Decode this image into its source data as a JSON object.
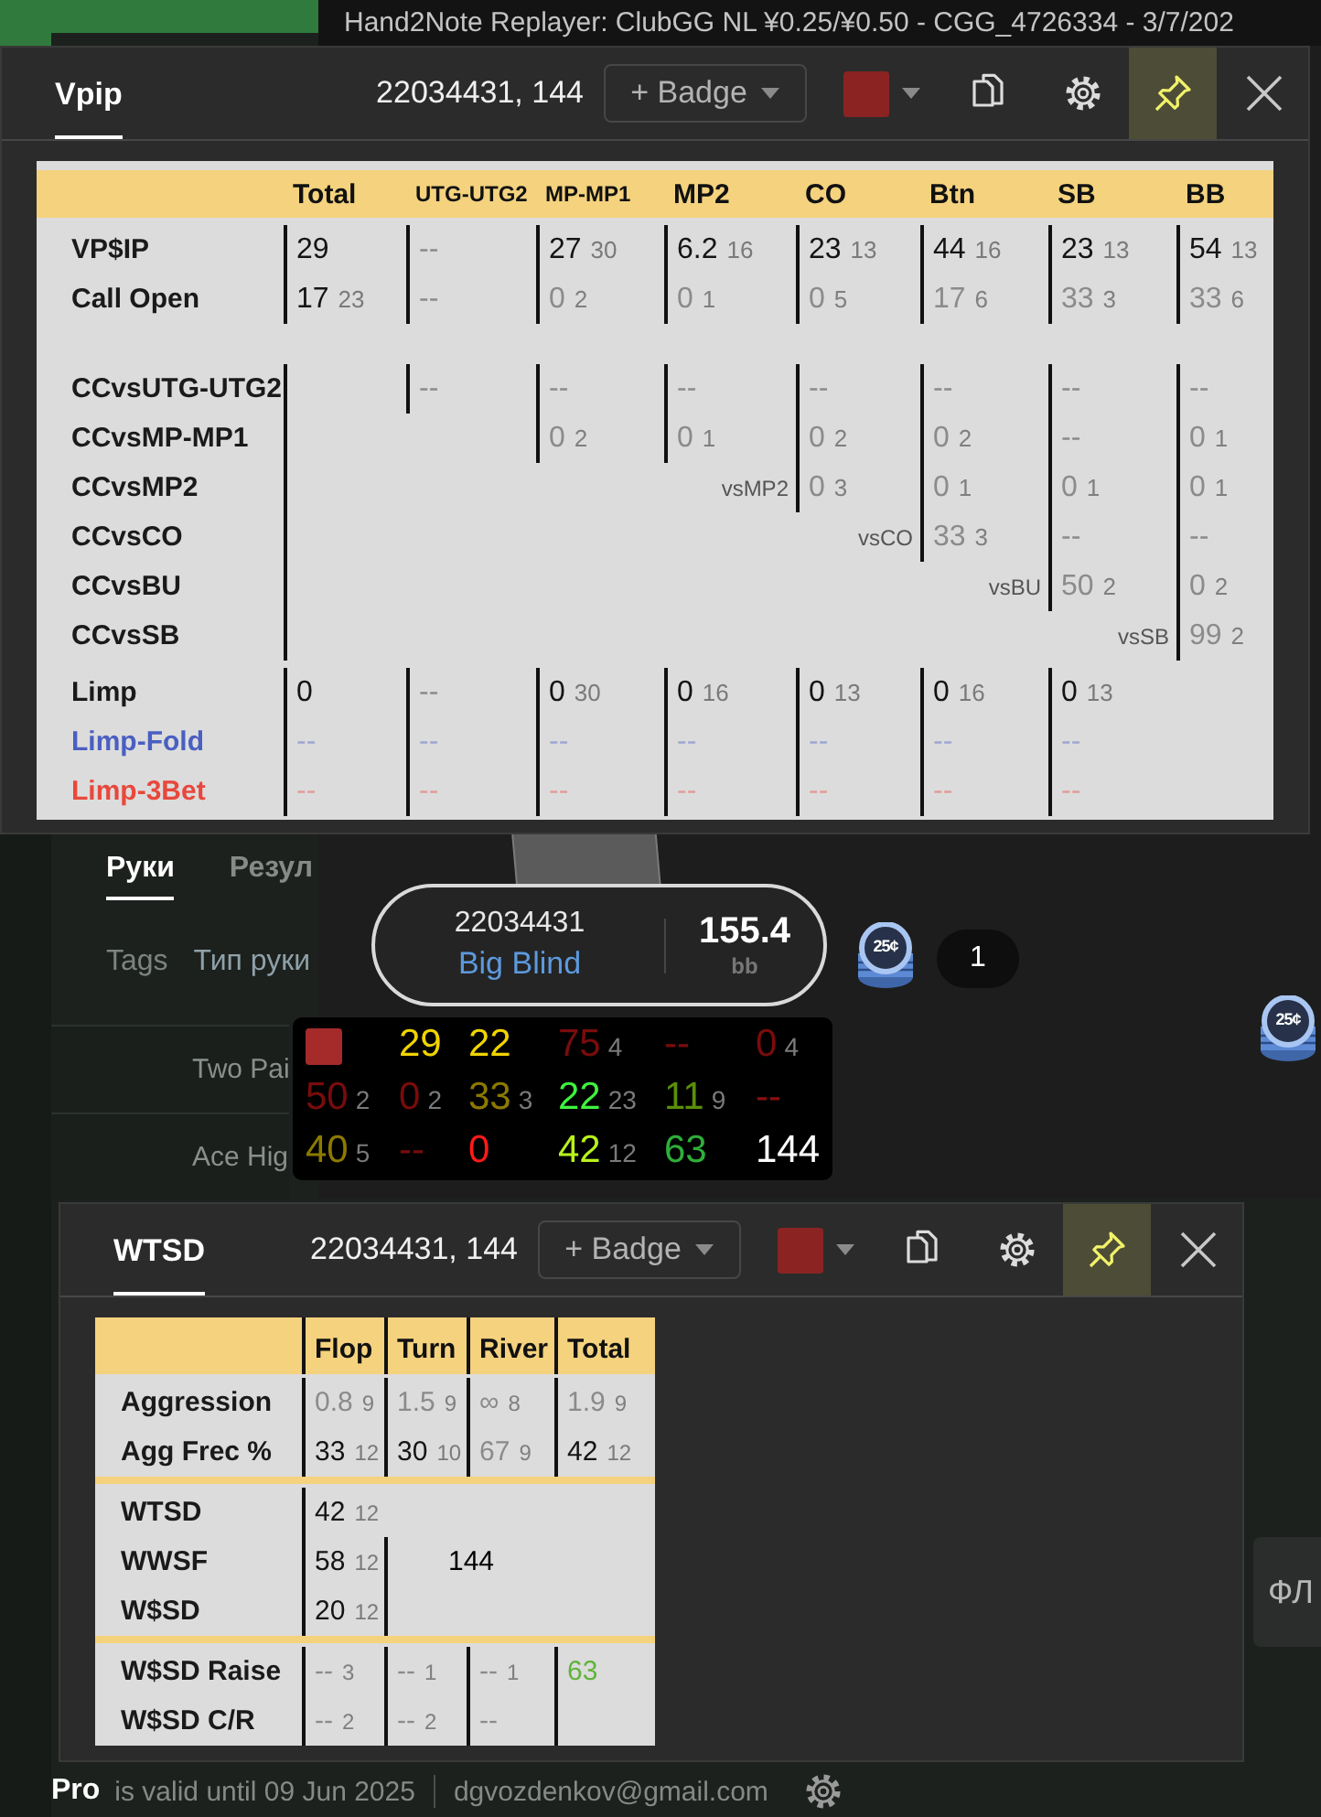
{
  "replayer": {
    "title": "Hand2Note Replayer: ClubGG NL ¥0.25/¥0.50 - CGG_4726334 - 3/7/202",
    "player": {
      "id": "22034431",
      "position": "Big Blind",
      "stack": "155.4",
      "unit": "bb"
    },
    "chips": [
      "25¢",
      "25¢"
    ],
    "bet": "1",
    "hud": {
      "rows": [
        [
          {
            "kind": "swatch",
            "color": "#a52a2a"
          },
          {
            "kind": "stat",
            "value": "29",
            "color": "#f0d400"
          },
          {
            "kind": "stat",
            "value": "22",
            "color": "#f0d400"
          },
          {
            "kind": "stat",
            "value": "75",
            "count": "4",
            "color": "#7a0c0c"
          },
          {
            "kind": "stat",
            "value": "--",
            "color": "#7a0c0c"
          },
          {
            "kind": "stat",
            "value": "0",
            "count": "4",
            "color": "#7a0c0c"
          }
        ],
        [
          {
            "kind": "stat",
            "value": "50",
            "count": "2",
            "color": "#7a0c0c"
          },
          {
            "kind": "stat",
            "value": "0",
            "count": "2",
            "color": "#7a0c0c"
          },
          {
            "kind": "stat",
            "value": "33",
            "count": "3",
            "color": "#8c7a00"
          },
          {
            "kind": "stat",
            "value": "22",
            "count": "23",
            "color": "#3ef23e"
          },
          {
            "kind": "stat",
            "value": "11",
            "count": "9",
            "color": "#5a8f0a"
          },
          {
            "kind": "stat",
            "value": "--",
            "color": "#8a1010"
          }
        ],
        [
          {
            "kind": "stat",
            "value": "40",
            "count": "5",
            "color": "#8c7a00"
          },
          {
            "kind": "stat",
            "value": "--",
            "color": "#7a0c0c"
          },
          {
            "kind": "stat",
            "value": "0",
            "color": "#ff1a1a"
          },
          {
            "kind": "stat",
            "value": "42",
            "count": "12",
            "color": "#b8f21c"
          },
          {
            "kind": "stat",
            "value": "63",
            "color": "#2fae3a"
          },
          {
            "kind": "stat",
            "value": "144",
            "color": "#ffffff"
          }
        ]
      ]
    }
  },
  "app": {
    "tabs": [
      {
        "label": "Руки",
        "selected": true
      },
      {
        "label": "Резул",
        "selected": false
      }
    ],
    "filters": [
      "Tags",
      "Тип руки"
    ],
    "hands": [
      "Two Pai",
      "Ace Hig"
    ],
    "side_button": "ФЛ",
    "footer": {
      "plan": "Pro",
      "validity": "is valid until 09 Jun 2025",
      "email": "dgvozdenkov@gmail.com"
    }
  },
  "popups": [
    {
      "tab": {
        "label": "Vpip",
        "selected": true
      },
      "players": "22034431, 144",
      "badge_button": "+ Badge",
      "color": "#8b2323",
      "pinned": true,
      "table": {
        "divider_lines": false,
        "header_rules": false,
        "columns": [
          "Total",
          "UTG-UTG2",
          "MP-MP1",
          "MP2",
          "CO",
          "Btn",
          "SB",
          "BB"
        ],
        "sections": [
          [
            {
              "label": "VP$IP",
              "color": "#1a1a1a",
              "cells": [
                {
                  "kind": "stat",
                  "value": "29",
                  "faded": false
                },
                {
                  "kind": "stat",
                  "value": "--",
                  "faded": true
                },
                {
                  "kind": "stat",
                  "value": "27",
                  "count": "30",
                  "faded": false
                },
                {
                  "kind": "stat",
                  "value": "6.2",
                  "count": "16",
                  "faded": false
                },
                {
                  "kind": "stat",
                  "value": "23",
                  "count": "13",
                  "faded": false
                },
                {
                  "kind": "stat",
                  "value": "44",
                  "count": "16",
                  "faded": false
                },
                {
                  "kind": "stat",
                  "value": "23",
                  "count": "13",
                  "faded": false
                },
                {
                  "kind": "stat",
                  "value": "54",
                  "count": "13",
                  "faded": false
                }
              ]
            },
            {
              "label": "Call Open",
              "color": "#1a1a1a",
              "cells": [
                {
                  "kind": "stat",
                  "value": "17",
                  "count": "23",
                  "faded": false
                },
                {
                  "kind": "stat",
                  "value": "--",
                  "faded": true
                },
                {
                  "kind": "stat",
                  "value": "0",
                  "count": "2",
                  "faded": true
                },
                {
                  "kind": "stat",
                  "value": "0",
                  "count": "1",
                  "faded": true
                },
                {
                  "kind": "stat",
                  "value": "0",
                  "count": "5",
                  "faded": true
                },
                {
                  "kind": "stat",
                  "value": "17",
                  "count": "6",
                  "faded": true
                },
                {
                  "kind": "stat",
                  "value": "33",
                  "count": "3",
                  "faded": true
                },
                {
                  "kind": "stat",
                  "value": "33",
                  "count": "6",
                  "faded": true
                }
              ]
            }
          ],
          [
            {
              "label": "CCvsUTG-UTG2",
              "color": "#1a1a1a",
              "cells": [
                {
                  "kind": "bar"
                },
                {
                  "kind": "stat",
                  "value": "--",
                  "faded": true
                },
                {
                  "kind": "stat",
                  "value": "--",
                  "faded": true
                },
                {
                  "kind": "stat",
                  "value": "--",
                  "faded": true
                },
                {
                  "kind": "stat",
                  "value": "--",
                  "faded": true
                },
                {
                  "kind": "stat",
                  "value": "--",
                  "faded": true
                },
                {
                  "kind": "stat",
                  "value": "--",
                  "faded": true
                },
                {
                  "kind": "stat",
                  "value": "--",
                  "faded": true
                }
              ]
            },
            {
              "label": "CCvsMP-MP1",
              "color": "#1a1a1a",
              "cells": [
                {
                  "kind": "bar"
                },
                {
                  "kind": "blank"
                },
                {
                  "kind": "stat",
                  "value": "0",
                  "count": "2",
                  "faded": true
                },
                {
                  "kind": "stat",
                  "value": "0",
                  "count": "1",
                  "faded": true
                },
                {
                  "kind": "stat",
                  "value": "0",
                  "count": "2",
                  "faded": true
                },
                {
                  "kind": "stat",
                  "value": "0",
                  "count": "2",
                  "faded": true
                },
                {
                  "kind": "stat",
                  "value": "--",
                  "faded": true
                },
                {
                  "kind": "stat",
                  "value": "0",
                  "count": "1",
                  "faded": true
                }
              ]
            },
            {
              "label": "CCvsMP2",
              "color": "#1a1a1a",
              "cells": [
                {
                  "kind": "bar"
                },
                {
                  "kind": "blank"
                },
                {
                  "kind": "blank"
                },
                {
                  "kind": "label",
                  "text": "vsMP2"
                },
                {
                  "kind": "stat",
                  "value": "0",
                  "count": "3",
                  "faded": true
                },
                {
                  "kind": "stat",
                  "value": "0",
                  "count": "1",
                  "faded": true
                },
                {
                  "kind": "stat",
                  "value": "0",
                  "count": "1",
                  "faded": true
                },
                {
                  "kind": "stat",
                  "value": "0",
                  "count": "1",
                  "faded": true
                }
              ]
            },
            {
              "label": "CCvsCO",
              "color": "#1a1a1a",
              "cells": [
                {
                  "kind": "bar"
                },
                {
                  "kind": "blank"
                },
                {
                  "kind": "blank"
                },
                {
                  "kind": "blank"
                },
                {
                  "kind": "label",
                  "text": "vsCO"
                },
                {
                  "kind": "stat",
                  "value": "33",
                  "count": "3",
                  "faded": true
                },
                {
                  "kind": "stat",
                  "value": "--",
                  "faded": true
                },
                {
                  "kind": "stat",
                  "value": "--",
                  "faded": true
                }
              ]
            },
            {
              "label": "CCvsBU",
              "color": "#1a1a1a",
              "cells": [
                {
                  "kind": "bar"
                },
                {
                  "kind": "blank"
                },
                {
                  "kind": "blank"
                },
                {
                  "kind": "blank"
                },
                {
                  "kind": "blank"
                },
                {
                  "kind": "label",
                  "text": "vsBU"
                },
                {
                  "kind": "stat",
                  "value": "50",
                  "count": "2",
                  "faded": true
                },
                {
                  "kind": "stat",
                  "value": "0",
                  "count": "2",
                  "faded": true
                }
              ]
            },
            {
              "label": "CCvsSB",
              "color": "#1a1a1a",
              "cells": [
                {
                  "kind": "bar"
                },
                {
                  "kind": "blank"
                },
                {
                  "kind": "blank"
                },
                {
                  "kind": "blank"
                },
                {
                  "kind": "blank"
                },
                {
                  "kind": "blank"
                },
                {
                  "kind": "label",
                  "text": "vsSB"
                },
                {
                  "kind": "stat",
                  "value": "99",
                  "count": "2",
                  "faded": true
                }
              ]
            }
          ],
          [
            {
              "label": "Limp",
              "color": "#1a1a1a",
              "cells": [
                {
                  "kind": "stat",
                  "value": "0",
                  "faded": false
                },
                {
                  "kind": "stat",
                  "value": "--",
                  "faded": true
                },
                {
                  "kind": "stat",
                  "value": "0",
                  "count": "30",
                  "faded": false
                },
                {
                  "kind": "stat",
                  "value": "0",
                  "count": "16",
                  "faded": false
                },
                {
                  "kind": "stat",
                  "value": "0",
                  "count": "13",
                  "faded": false
                },
                {
                  "kind": "stat",
                  "value": "0",
                  "count": "16",
                  "faded": false
                },
                {
                  "kind": "stat",
                  "value": "0",
                  "count": "13",
                  "faded": false
                },
                {
                  "kind": "blank"
                }
              ]
            },
            {
              "label": "Limp-Fold",
              "color": "#4a5fc1",
              "cells": [
                {
                  "kind": "stat",
                  "value": "--",
                  "faded": true
                },
                {
                  "kind": "stat",
                  "value": "--",
                  "faded": true
                },
                {
                  "kind": "stat",
                  "value": "--",
                  "faded": true
                },
                {
                  "kind": "stat",
                  "value": "--",
                  "faded": true
                },
                {
                  "kind": "stat",
                  "value": "--",
                  "faded": true
                },
                {
                  "kind": "stat",
                  "value": "--",
                  "faded": true
                },
                {
                  "kind": "stat",
                  "value": "--",
                  "faded": true
                },
                {
                  "kind": "blank"
                }
              ]
            },
            {
              "label": "Limp-3Bet",
              "color": "#e8483c",
              "cells": [
                {
                  "kind": "stat",
                  "value": "--",
                  "faded": true
                },
                {
                  "kind": "stat",
                  "value": "--",
                  "faded": true
                },
                {
                  "kind": "stat",
                  "value": "--",
                  "faded": true
                },
                {
                  "kind": "stat",
                  "value": "--",
                  "faded": true
                },
                {
                  "kind": "stat",
                  "value": "--",
                  "faded": true
                },
                {
                  "kind": "stat",
                  "value": "--",
                  "faded": true
                },
                {
                  "kind": "stat",
                  "value": "--",
                  "faded": true
                },
                {
                  "kind": "blank"
                }
              ]
            }
          ]
        ]
      }
    },
    {
      "tab": {
        "label": "WTSD",
        "selected": true
      },
      "players": "22034431, 144",
      "badge_button": "+ Badge",
      "color": "#8b2323",
      "pinned": true,
      "table": {
        "divider_lines": true,
        "header_rules": true,
        "columns": [
          "Flop",
          "Turn",
          "River",
          "Total"
        ],
        "sections": [
          [
            {
              "label": "Aggression",
              "color": "#1a1a1a",
              "cells": [
                {
                  "kind": "stat",
                  "value": "0.8",
                  "count": "9",
                  "faded": true
                },
                {
                  "kind": "stat",
                  "value": "1.5",
                  "count": "9",
                  "faded": true
                },
                {
                  "kind": "stat",
                  "value": "∞",
                  "count": "8",
                  "faded": true
                },
                {
                  "kind": "stat",
                  "value": "1.9",
                  "count": "9",
                  "faded": true
                }
              ]
            },
            {
              "label": "Agg Frec %",
              "color": "#1a1a1a",
              "cells": [
                {
                  "kind": "stat",
                  "value": "33",
                  "count": "12",
                  "faded": false
                },
                {
                  "kind": "stat",
                  "value": "30",
                  "count": "10",
                  "faded": false
                },
                {
                  "kind": "stat",
                  "value": "67",
                  "count": "9",
                  "faded": true
                },
                {
                  "kind": "stat",
                  "value": "42",
                  "count": "12",
                  "faded": false
                }
              ]
            }
          ],
          [
            {
              "label": "WTSD",
              "color": "#1a1a1a",
              "cells": [
                {
                  "kind": "stat",
                  "value": "42",
                  "count": "12",
                  "faded": false
                },
                {
                  "kind": "blank"
                },
                {
                  "kind": "blank"
                },
                {
                  "kind": "blank"
                }
              ]
            },
            {
              "label": "WWSF",
              "color": "#1a1a1a",
              "cells": [
                {
                  "kind": "stat",
                  "value": "58",
                  "count": "12",
                  "faded": false
                },
                {
                  "kind": "wide",
                  "value": "144"
                },
                {
                  "kind": "blank"
                }
              ]
            },
            {
              "label": "W$SD",
              "color": "#1a1a1a",
              "cells": [
                {
                  "kind": "stat",
                  "value": "20",
                  "count": "12",
                  "faded": false
                },
                {
                  "kind": "bar"
                },
                {
                  "kind": "blank"
                },
                {
                  "kind": "blank"
                }
              ]
            }
          ],
          [
            {
              "label": "W$SD Raise",
              "color": "#1a1a1a",
              "cells": [
                {
                  "kind": "stat",
                  "value": "--",
                  "count": "3",
                  "faded": true
                },
                {
                  "kind": "stat",
                  "value": "--",
                  "count": "1",
                  "faded": true
                },
                {
                  "kind": "stat",
                  "value": "--",
                  "count": "1",
                  "faded": true
                },
                {
                  "kind": "stat",
                  "value": "63",
                  "color": "#5fb43a"
                }
              ]
            },
            {
              "label": "W$SD C/R",
              "color": "#1a1a1a",
              "cells": [
                {
                  "kind": "stat",
                  "value": "--",
                  "count": "2",
                  "faded": true
                },
                {
                  "kind": "stat",
                  "value": "--",
                  "count": "2",
                  "faded": true
                },
                {
                  "kind": "stat",
                  "value": "--",
                  "faded": true
                },
                {
                  "kind": "bar"
                }
              ]
            }
          ]
        ]
      }
    }
  ]
}
